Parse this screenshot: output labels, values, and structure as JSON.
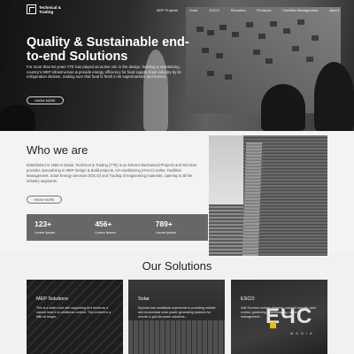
{
  "brand": {
    "name": "Technical & Trading"
  },
  "nav": {
    "items": [
      "MEP Projects",
      "Solar",
      "ESCO",
      "Elevators",
      "Products",
      "Facilities Management",
      "About"
    ]
  },
  "hero": {
    "title": "Quality & Sustainable end-to-end Solutions",
    "description": "For more than 50 years TTE has played an active role in the design, building & maintaining country's MEP infrastructure & provide energy efficiency for food supply chain industry by its refrigeration division, making sure that food is fresh in its supermarkets and homes.",
    "cta": "KNOW MORE"
  },
  "who": {
    "title": "Who we are",
    "description": "Established in 1969 in Dubai, Technical & Trading (TTE) is an Electro-Mechanical Projects and Services provider, specializing in MEP Design & Build projects, Air-conditioning (HVAC) works, Facilities Management, Solar Energy Services (ESCO) and Trading of engineering materials, catering to all the industry segments.",
    "cta": "KNOW MORE",
    "stats": [
      {
        "value": "123+",
        "label": "Lorum Ipsum"
      },
      {
        "value": "456+",
        "label": "Lorum Ipsum"
      },
      {
        "value": "789+",
        "label": "Lorum Ipsum"
      }
    ]
  },
  "solutions": {
    "title": "Our Solutions",
    "cards": [
      {
        "title": "MEP Solutions",
        "description": "This is a wider card with supporting text below as a natural lead-in to additional content. This content is a little bit longer."
      },
      {
        "title": "Solar",
        "description": "Kyocera has worldwide experience in providing reliable and economical solar power generating systems for remote & grid-tie power solutions..."
      },
      {
        "title": "ESCO",
        "description": "Soft Services include cleaning, manned security, pest control, gardening & landscaping, waste management..."
      }
    ]
  },
  "watermark": {
    "big": "ЕЧС",
    "small": "MEDIA"
  }
}
